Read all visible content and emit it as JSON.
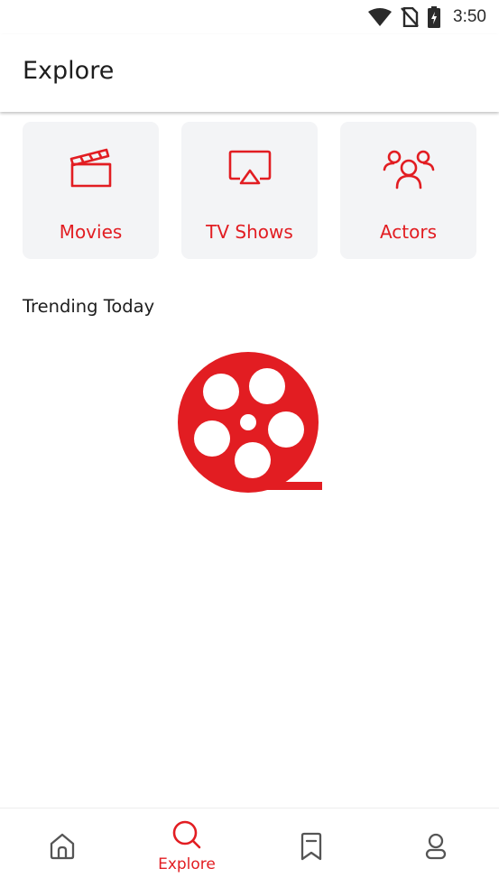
{
  "status_bar": {
    "time": "3:50",
    "icons": [
      "wifi-icon",
      "no-sim-icon",
      "battery-charging-icon"
    ]
  },
  "app_bar": {
    "title": "Explore"
  },
  "categories": [
    {
      "label": "Movies",
      "icon": "clapperboard-icon"
    },
    {
      "label": "TV Shows",
      "icon": "tv-cast-icon"
    },
    {
      "label": "Actors",
      "icon": "people-icon"
    }
  ],
  "trending": {
    "title": "Trending Today",
    "loading_icon": "film-reel-icon"
  },
  "bottom_nav": {
    "items": [
      {
        "icon": "home-icon",
        "label": ""
      },
      {
        "icon": "search-icon",
        "label": "Explore",
        "active": true
      },
      {
        "icon": "bookmark-icon",
        "label": ""
      },
      {
        "icon": "profile-icon",
        "label": ""
      }
    ]
  },
  "colors": {
    "accent": "#e21d22",
    "card_background": "#f3f4f6",
    "text": "#1d1d1d",
    "nav_inactive": "#555555"
  }
}
